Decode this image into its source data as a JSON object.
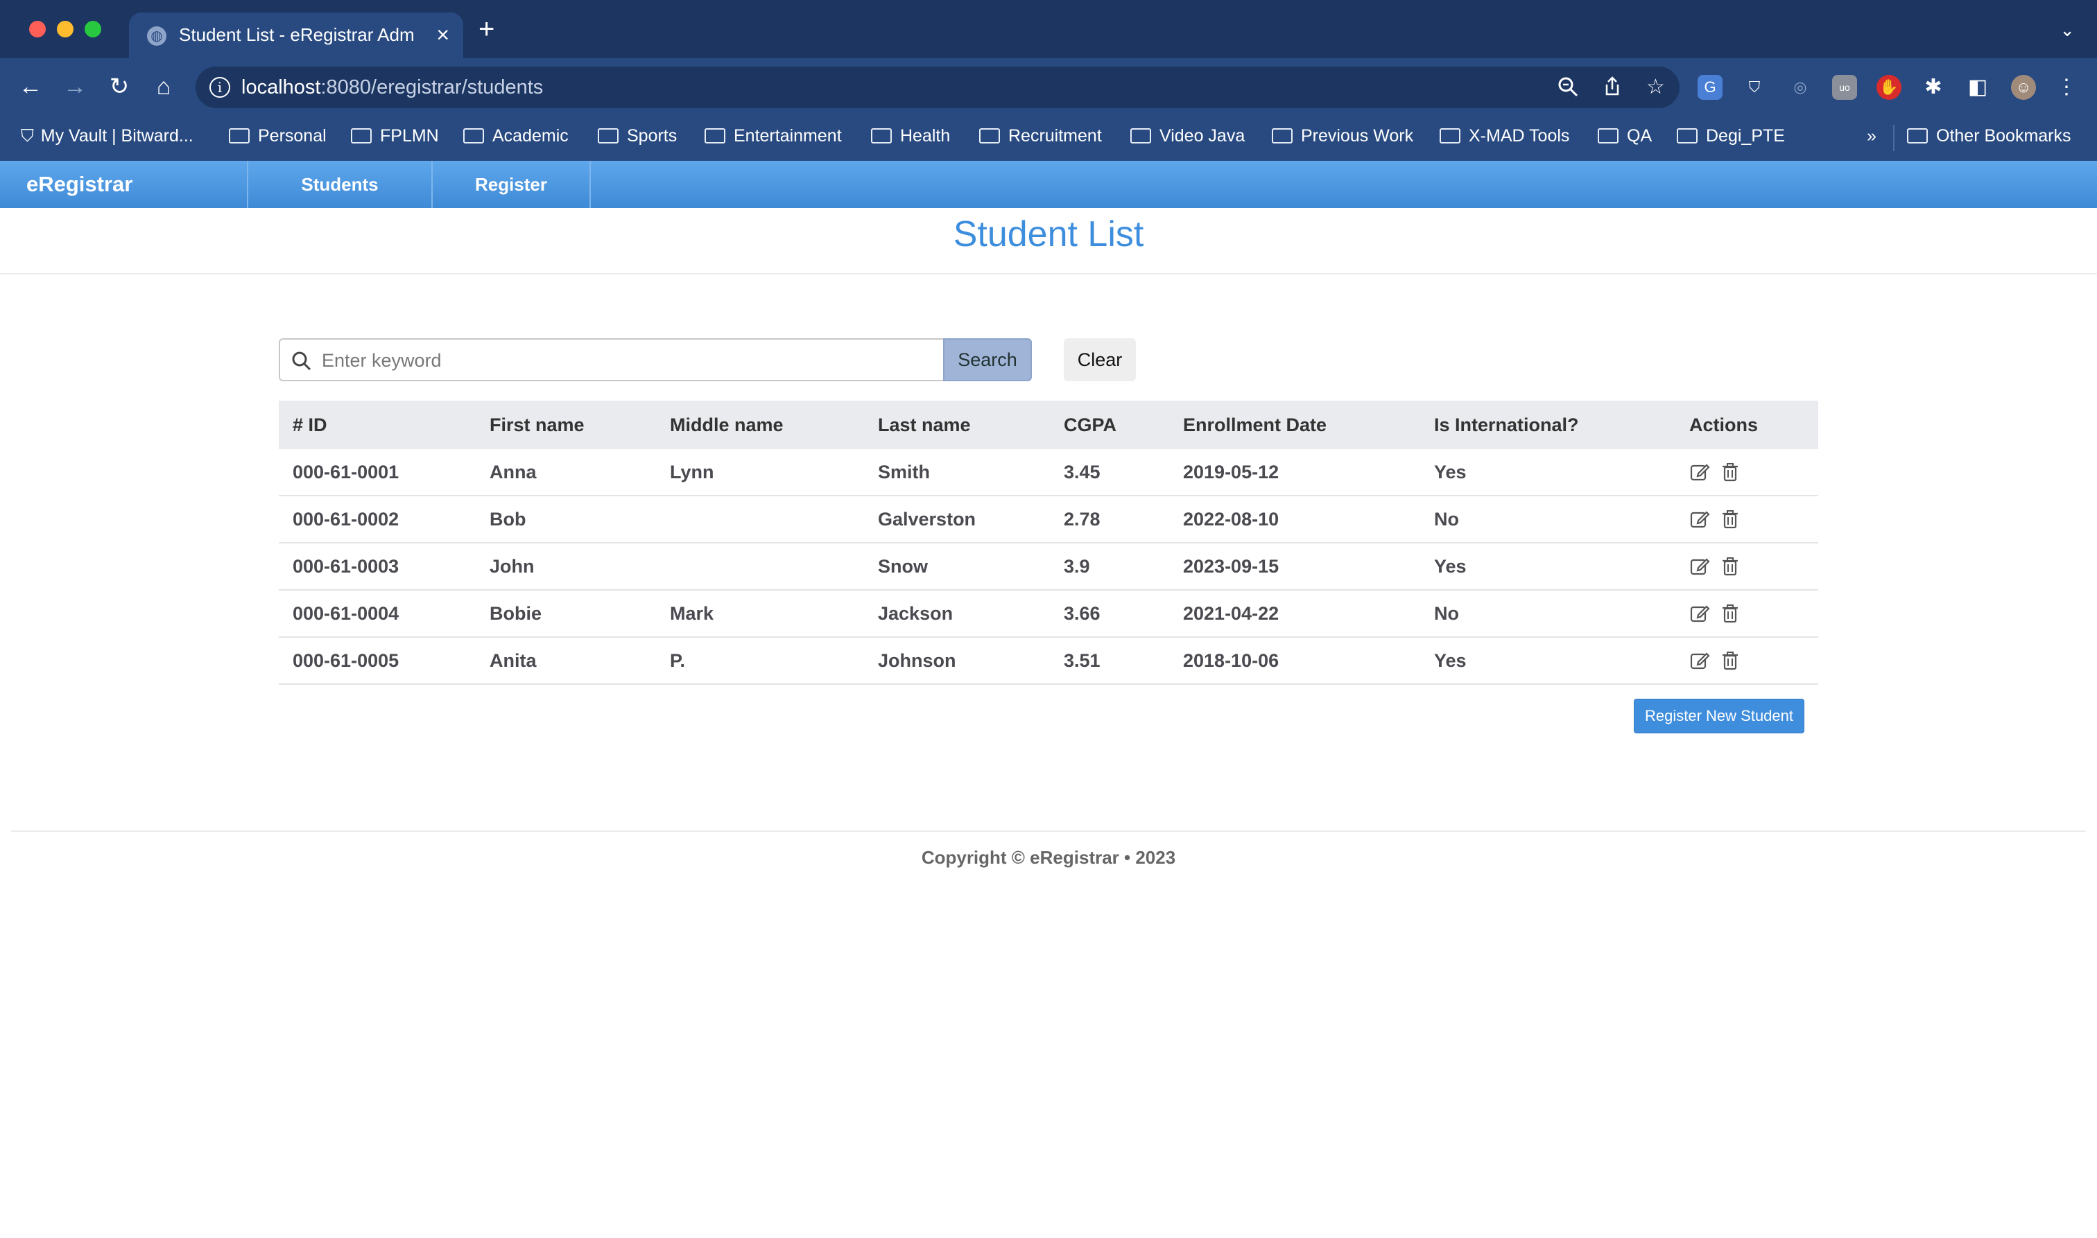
{
  "browser": {
    "tab_title": "Student List - eRegistrar Admin",
    "url_host": "localhost",
    "url_path": ":8080/eregistrar/students",
    "bookmarks": [
      "My Vault | Bitward...",
      "Personal",
      "FPLMN",
      "Academic",
      "Sports",
      "Entertainment",
      "Health",
      "Recruitment",
      "Video Java",
      "Previous Work",
      "X-MAD Tools",
      "QA",
      "Degi_PTE"
    ],
    "bookmarks_overflow": "»",
    "other_bookmarks": "Other Bookmarks"
  },
  "app": {
    "brand": "eRegistrar",
    "nav": [
      "Students",
      "Register"
    ],
    "page_title": "Student List"
  },
  "search": {
    "placeholder": "Enter keyword",
    "button": "Search",
    "clear": "Clear"
  },
  "table": {
    "headers": [
      "# ID",
      "First name",
      "Middle name",
      "Last name",
      "CGPA",
      "Enrollment Date",
      "Is International?",
      "Actions"
    ],
    "rows": [
      [
        "000-61-0001",
        "Anna",
        "Lynn",
        "Smith",
        "3.45",
        "2019-05-12",
        "Yes"
      ],
      [
        "000-61-0002",
        "Bob",
        "",
        "Galverston",
        "2.78",
        "2022-08-10",
        "No"
      ],
      [
        "000-61-0003",
        "John",
        "",
        "Snow",
        "3.9",
        "2023-09-15",
        "Yes"
      ],
      [
        "000-61-0004",
        "Bobie",
        "Mark",
        "Jackson",
        "3.66",
        "2021-04-22",
        "No"
      ],
      [
        "000-61-0005",
        "Anita",
        "P.",
        "Johnson",
        "3.51",
        "2018-10-06",
        "Yes"
      ]
    ]
  },
  "register_button": "Register New Student",
  "footer": "Copyright © eRegistrar • 2023",
  "colors": {
    "navbar": "#4a96e0",
    "title": "#3e8ede",
    "browser_chrome": "#284a80"
  }
}
